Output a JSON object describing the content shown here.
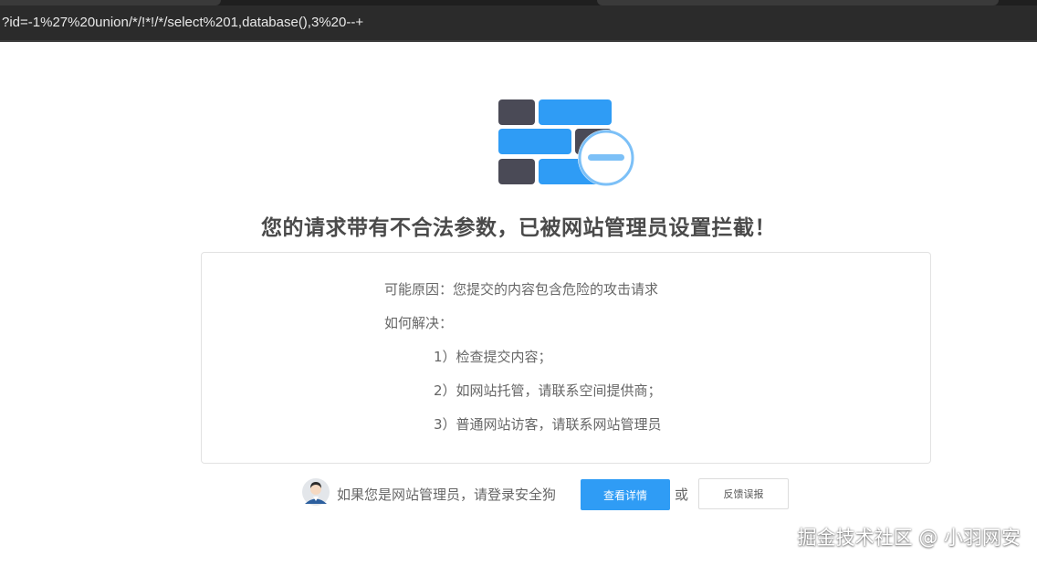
{
  "browser": {
    "url_fragment": "?id=-1%27%20union/*/!*!/*/select%201,database(),3%20--+"
  },
  "page": {
    "headline": "您的请求带有不合法参数，已被网站管理员设置拦截！",
    "reason": "可能原因：您提交的内容包含危险的攻击请求",
    "how_to_solve": "如何解决：",
    "solutions": [
      "1）检查提交内容；",
      "2）如网站托管，请联系空间提供商；",
      "3）普通网站访客，请联系网站管理员"
    ]
  },
  "footer": {
    "admin_prompt": "如果您是网站管理员，请登录安全狗",
    "details_button": "查看详情",
    "or_text": "或",
    "feedback_button": "反馈误报"
  },
  "watermark": "掘金技术社区 @ 小羽网安",
  "colors": {
    "accent_blue": "#2f9cf5",
    "brick_dark": "#4a4a56",
    "text_gray": "#666666"
  },
  "icons": {
    "firewall": "firewall-block-icon",
    "avatar": "admin-avatar-icon"
  }
}
